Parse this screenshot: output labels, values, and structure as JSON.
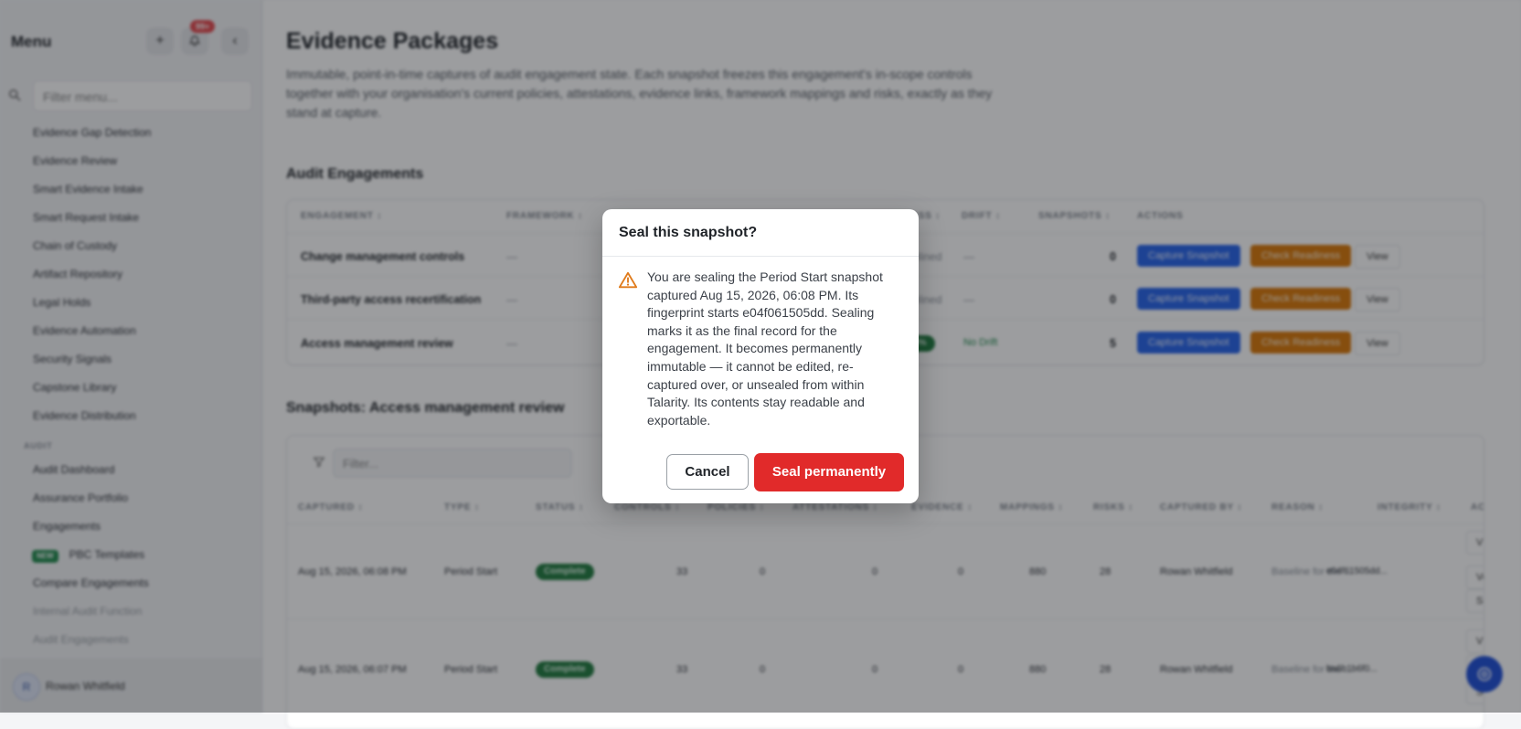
{
  "sidebar": {
    "title": "Menu",
    "add_icon": "+",
    "bell_badge": "99+",
    "collapse_icon": "‹",
    "filter_placeholder": "Filter menu...",
    "items": [
      {
        "label": "Evidence Gap Detection"
      },
      {
        "label": "Evidence Review"
      },
      {
        "label": "Smart Evidence Intake"
      },
      {
        "label": "Smart Request Intake"
      },
      {
        "label": "Chain of Custody"
      },
      {
        "label": "Artifact Repository"
      },
      {
        "label": "Legal Holds"
      },
      {
        "label": "Evidence Automation"
      },
      {
        "label": "Security Signals"
      },
      {
        "label": "Capstone Library"
      },
      {
        "label": "Evidence Distribution"
      }
    ],
    "audit_section": "AUDIT",
    "audit_items": [
      {
        "label": "Audit Dashboard"
      },
      {
        "label": "Assurance Portfolio"
      },
      {
        "label": "Engagements"
      },
      {
        "label": "PBC Templates",
        "badge": "NEW"
      },
      {
        "label": "Compare Engagements"
      },
      {
        "label": "Internal Audit Function"
      },
      {
        "label": "Audit Engagements"
      }
    ],
    "user_initial": "R",
    "user_name": "Rowan Whitfield"
  },
  "main": {
    "title": "Evidence Packages",
    "description": "Immutable, point-in-time captures of audit engagement state. Each snapshot freezes this engagement's in-scope controls together with your organisation's current policies, attestations, evidence links, framework mappings and risks, exactly as they stand at capture.",
    "engagements": {
      "title": "Audit Engagements",
      "headers": {
        "engagement": "ENGAGEMENT ↕",
        "framework": "FRAMEWORK ↕",
        "readiness": "READINESS ↕",
        "drift": "DRIFT ↕",
        "snapshots": "SNAPSHOTS ↕",
        "actions": "ACTIONS"
      },
      "rows": [
        {
          "name": "Change management controls",
          "framework": "—",
          "readiness": "Not baselined",
          "drift": "—",
          "snapshots": "0"
        },
        {
          "name": "Third-party access recertification",
          "framework": "—",
          "readiness": "Not baselined",
          "drift": "—",
          "snapshots": "0"
        },
        {
          "name": "Access management review",
          "framework": "—",
          "readiness": "100%",
          "drift": "No Drift",
          "snapshots": "5"
        }
      ],
      "capture_label": "Capture Snapshot",
      "readiness_label": "Check Readiness",
      "view_label": "View"
    },
    "snapshots": {
      "title": "Snapshots: Access management review",
      "filter_placeholder": "Filter...",
      "headers": {
        "captured": "CAPTURED ↕",
        "type": "TYPE ↕",
        "status": "STATUS ↕",
        "controls": "CONTROLS ↕",
        "policies": "POLICIES ↕",
        "attestations": "ATTESTATIONS ↕",
        "evidence": "EVIDENCE ↕",
        "mappings": "MAPPINGS ↕",
        "risks": "RISKS ↕",
        "captured_by": "CAPTURED BY ↕",
        "reason": "REASON ↕",
        "integrity": "INTEGRITY ↕",
        "actions": "ACTI"
      },
      "rows": [
        {
          "captured": "Aug 15, 2026, 06:08 PM",
          "type": "Period Start",
          "status": "Complete",
          "controls": "33",
          "policies": "0",
          "attestations": "0",
          "evidence": "0",
          "mappings": "880",
          "risks": "28",
          "captured_by": "Rowan Whitfield",
          "reason": "Baseline for the ...",
          "integrity": "e04f61505dd..."
        },
        {
          "captured": "Aug 15, 2026, 06:07 PM",
          "type": "Period Start",
          "status": "Complete",
          "controls": "33",
          "policies": "0",
          "attestations": "0",
          "evidence": "0",
          "mappings": "880",
          "risks": "28",
          "captured_by": "Rowan Whitfield",
          "reason": "Baseline for the ...",
          "integrity": "ba6b1b6f0..."
        }
      ],
      "row_action_1": "V",
      "row_action_2": "Ve",
      "row_action_3": "Se"
    }
  },
  "modal": {
    "title": "Seal this snapshot?",
    "body": "You are sealing the Period Start snapshot captured Aug 15, 2026, 06:08 PM. Its fingerprint starts e04f061505dd. Sealing marks it as the final record for the engagement. It becomes permanently immutable — it cannot be edited, re-captured over, or unsealed from within Talarity. Its contents stay readable and exportable.",
    "cancel_label": "Cancel",
    "confirm_label": "Seal permanently",
    "warning_icon": "warning-triangle-icon",
    "colors": {
      "confirm": "#e12a2a",
      "warning": "#e07a1a"
    }
  }
}
